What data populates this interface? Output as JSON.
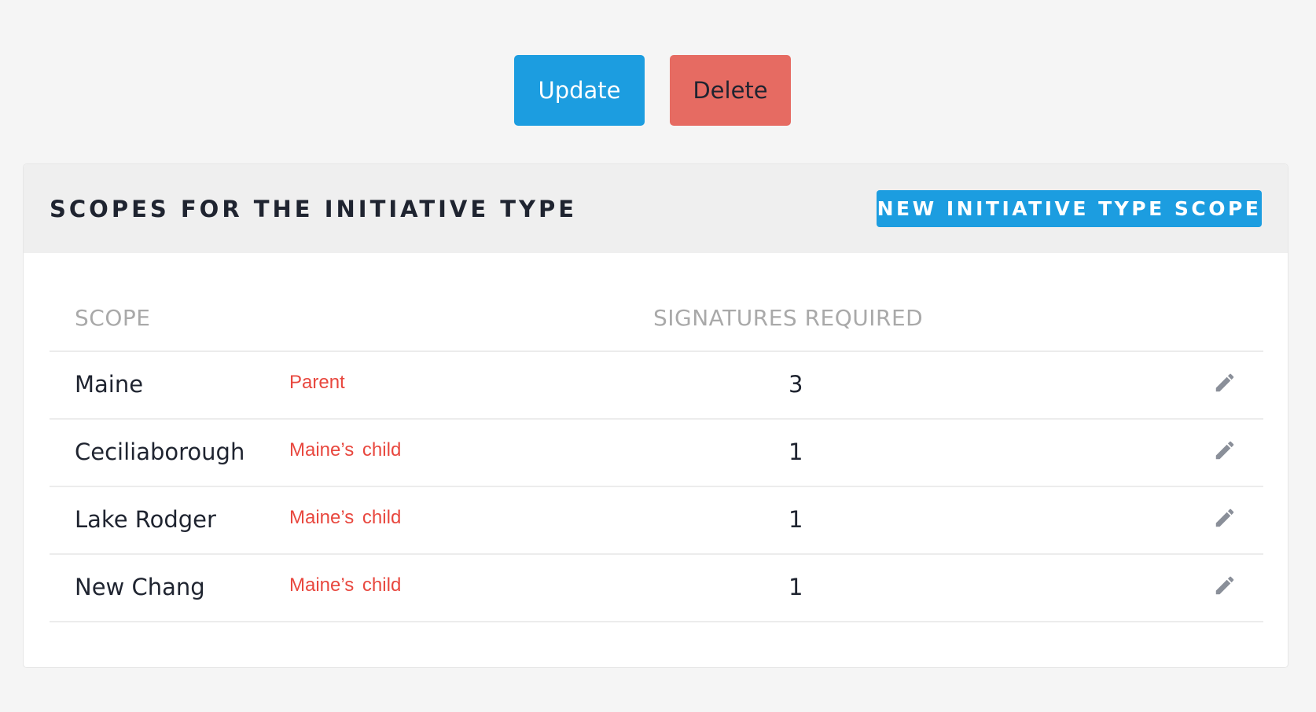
{
  "actions": {
    "update_label": "Update",
    "delete_label": "Delete"
  },
  "scopes_card": {
    "title": "SCOPES FOR THE INITIATIVE TYPE",
    "new_button_label": "NEW INITIATIVE TYPE SCOPE",
    "columns": {
      "scope": "SCOPE",
      "signatures": "SIGNATURES REQUIRED"
    },
    "rows": [
      {
        "scope": "Maine",
        "tag": "Parent",
        "signatures": "3",
        "icon": "pencil-icon"
      },
      {
        "scope": "Ceciliaborough",
        "tag": "Maine’s child",
        "signatures": "1",
        "icon": "pencil-icon"
      },
      {
        "scope": "Lake Rodger",
        "tag": "Maine’s child",
        "signatures": "1",
        "icon": "pencil-icon"
      },
      {
        "scope": "New Chang",
        "tag": "Maine’s child",
        "signatures": "1",
        "icon": "pencil-icon"
      }
    ]
  },
  "colors": {
    "primary": "#1c9de0",
    "danger": "#e66b62",
    "tag_text": "#e8473e",
    "icon": "#8a8f99"
  }
}
